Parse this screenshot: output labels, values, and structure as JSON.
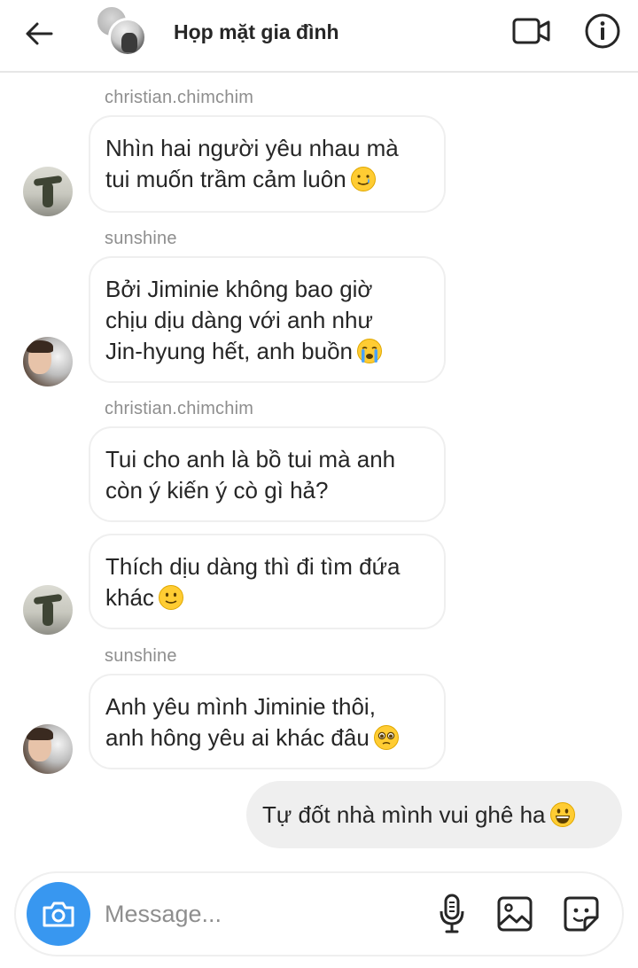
{
  "header": {
    "title": "Họp mặt gia đình",
    "back_icon": "arrow-left-icon",
    "video_icon": "video-call-icon",
    "info_icon": "info-icon"
  },
  "messages": [
    {
      "sender": "christian.chimchim",
      "lines": [
        "Nhìn hai người yêu nhau mà",
        "tui muốn trầm cảm luôn"
      ],
      "emoji": "tearful-smile"
    },
    {
      "sender": "sunshine",
      "lines": [
        "Bởi Jiminie không bao giờ",
        "chịu dịu dàng với anh như",
        "Jin-hyung hết, anh buồn"
      ],
      "emoji": "crying"
    },
    {
      "sender": "christian.chimchim",
      "lines": [
        "Tui cho anh là bồ tui mà anh",
        "còn ý kiến ý cò gì hả?"
      ]
    },
    {
      "lines": [
        "Thích dịu dàng thì đi tìm đứa",
        "khác"
      ],
      "emoji": "slight-smile"
    },
    {
      "sender": "sunshine",
      "lines": [
        "Anh yêu mình Jiminie thôi,",
        "anh hông yêu ai khác đâu"
      ],
      "emoji": "pleading"
    }
  ],
  "outgoing": {
    "text": "Tự đốt nhà mình vui ghê ha",
    "emoji": "grinning"
  },
  "composer": {
    "placeholder": "Message...",
    "camera_icon": "camera-icon",
    "mic_icon": "microphone-icon",
    "gallery_icon": "gallery-icon",
    "sticker_icon": "sticker-icon"
  },
  "colors": {
    "accent": "#3897f0",
    "bubble_border": "#efefef",
    "outgoing_bg": "#efefef",
    "meta_text": "#8e8e8e"
  }
}
